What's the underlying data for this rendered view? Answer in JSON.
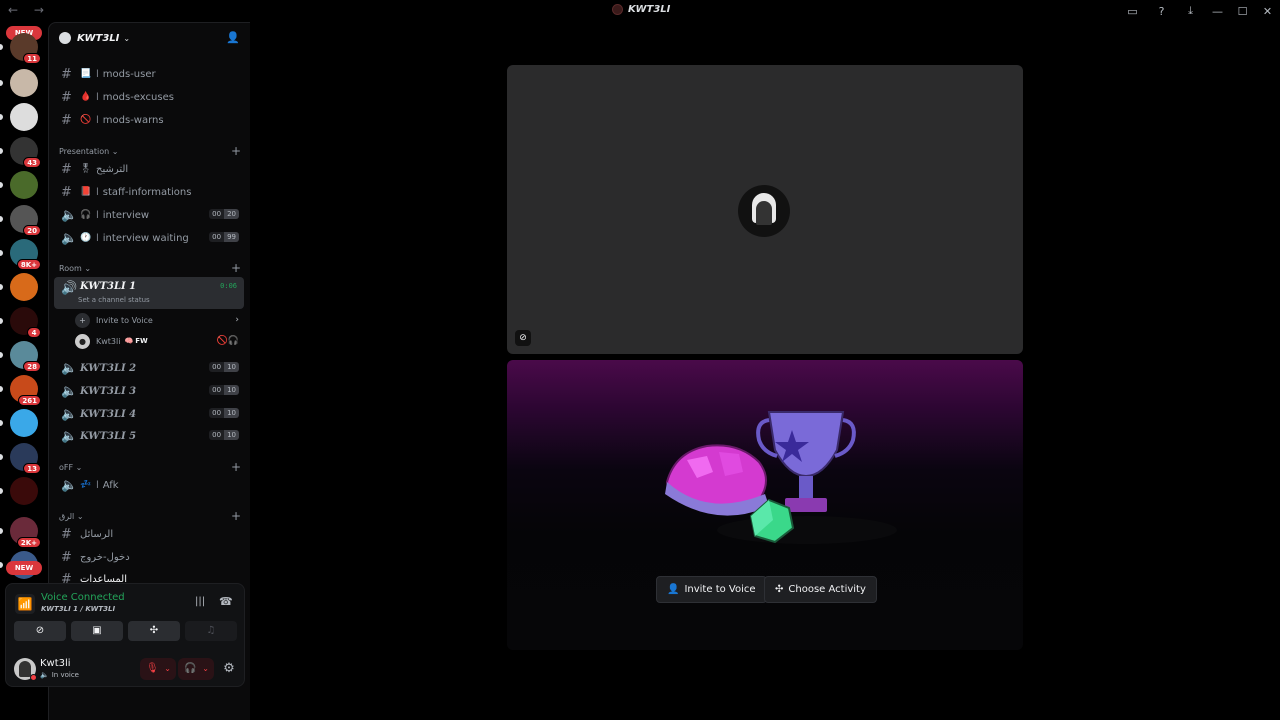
{
  "titlebar": {
    "nav": "← →",
    "title": "KWT3LI",
    "icons": [
      "screen-share-icon",
      "help-icon",
      "download-icon"
    ],
    "window_controls": [
      "—",
      "☐",
      "✕"
    ]
  },
  "rail": {
    "new_top": "NEW",
    "new_bottom": "NEW",
    "servers": [
      {
        "badge": "11",
        "color": "#5a3a2a"
      },
      {
        "badge": "",
        "color": "#c8b8a8"
      },
      {
        "badge": "",
        "color": "#ddd"
      },
      {
        "badge": "43",
        "color": "#333"
      },
      {
        "badge": "",
        "color": "#4a6a2a"
      },
      {
        "badge": "20",
        "color": "#555"
      },
      {
        "badge": "8K+",
        "color": "#2a6a7a"
      },
      {
        "badge": "",
        "color": "#d86a1a"
      },
      {
        "badge": "4",
        "color": "#2a0a0a"
      },
      {
        "badge": "28",
        "color": "#5a8a9a"
      },
      {
        "badge": "261",
        "color": "#c84a1a"
      },
      {
        "badge": "",
        "color": "#3aa8e8"
      },
      {
        "badge": "13",
        "color": "#2a3a5a"
      },
      {
        "badge": "",
        "color": "#3a0a0a"
      },
      {
        "badge": "2K+",
        "color": "#6a2a3a"
      },
      {
        "badge": "",
        "color": "#3a5a8a"
      }
    ]
  },
  "guild": {
    "name": "KWT3LI",
    "chevron": "⌄"
  },
  "channels_top": [
    {
      "emoji": "📃",
      "name": "mods-user"
    },
    {
      "emoji": "🩸",
      "name": "mods-excuses"
    },
    {
      "emoji": "🚫",
      "name": "mods-warns"
    }
  ],
  "categories": {
    "presentation": "Presentation",
    "room": "Room",
    "off": "oFF",
    "arabic": "الرق"
  },
  "presentation_channels": [
    {
      "type": "text",
      "emoji": "🎖",
      "name": "الترشيح"
    },
    {
      "type": "text",
      "emoji": "📕",
      "name": "staff-informations"
    },
    {
      "type": "voice",
      "emoji": "🎧",
      "name": "interview",
      "c1": "00",
      "c2": "20"
    },
    {
      "type": "voice",
      "emoji": "🕐",
      "name": "interview waiting",
      "c1": "00",
      "c2": "99"
    }
  ],
  "room": {
    "active_name": "KWT3LI 1",
    "time": "0:06",
    "status": "Set a channel status",
    "invite": "Invite to Voice",
    "member": "Kwt3li",
    "member_tag": "FW",
    "others": [
      {
        "name": "KWT3LI 2",
        "c1": "00",
        "c2": "10"
      },
      {
        "name": "KWT3LI 3",
        "c1": "00",
        "c2": "10"
      },
      {
        "name": "KWT3LI 4",
        "c1": "00",
        "c2": "10"
      },
      {
        "name": "KWT3LI 5",
        "c1": "00",
        "c2": "10"
      }
    ]
  },
  "off_channels": [
    {
      "emoji": "💤",
      "name": "Afk"
    }
  ],
  "arabic_channels": [
    {
      "name": "الرسائل"
    },
    {
      "name": "دخول-خروج"
    },
    {
      "name": "المساعدات"
    }
  ],
  "voice_panel": {
    "title": "Voice Connected",
    "subtitle": "KWT3LI 1 / KWT3LI",
    "buttons": [
      "camera-off-icon",
      "screen-share-icon",
      "activity-icon",
      "soundboard-icon"
    ]
  },
  "user": {
    "name": "Kwt3li",
    "status": "In voice"
  },
  "main": {
    "invite_label": "Invite to Voice",
    "activity_label": "Choose Activity"
  },
  "colors": {
    "green": "#23a55a",
    "red": "#f23f43",
    "purple": "#8a3ab0"
  }
}
